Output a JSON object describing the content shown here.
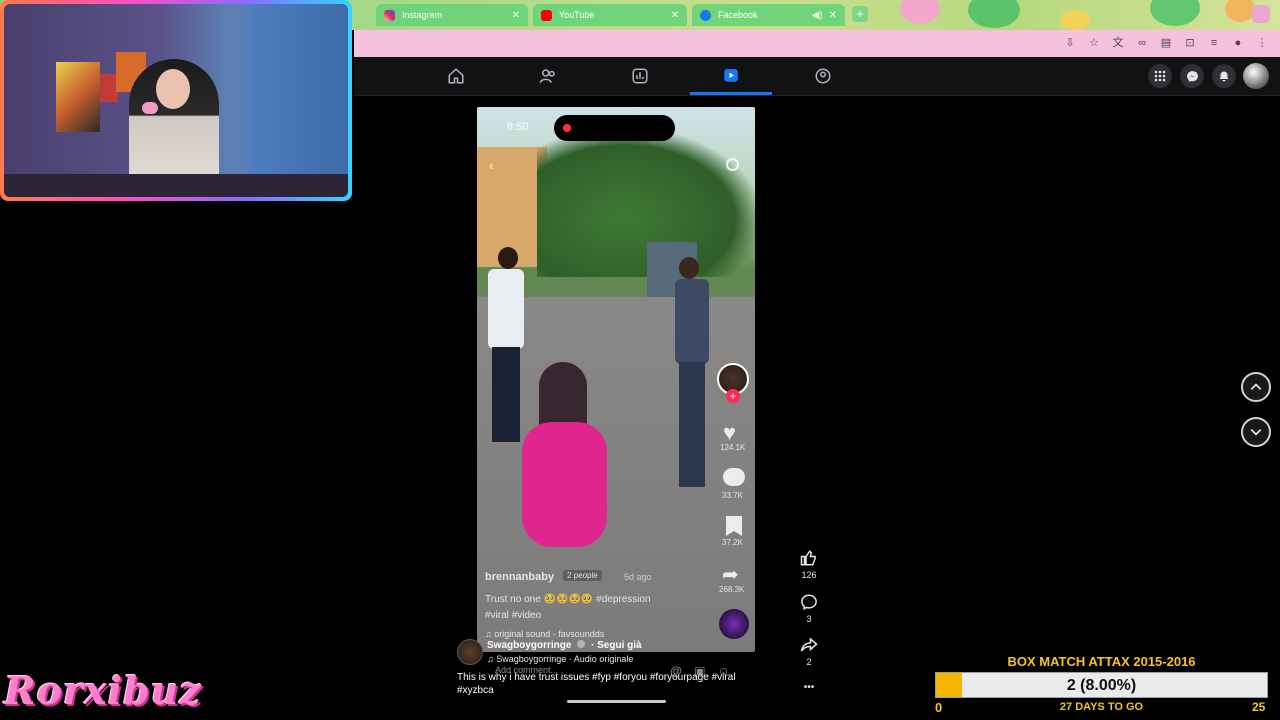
{
  "browser": {
    "tabs": [
      {
        "label": "Instagram",
        "icon": "instagram-icon",
        "color": "#e1306c"
      },
      {
        "label": "YouTube",
        "icon": "youtube-icon",
        "color": "#ff0000"
      },
      {
        "label": "Facebook",
        "icon": "facebook-icon",
        "color": "#1877f2"
      }
    ],
    "new_tab_label": "+"
  },
  "facebook_nav": {
    "items": [
      "home-icon",
      "friends-icon",
      "dashboard-icon",
      "video-icon",
      "groups-icon"
    ],
    "active_index": 3,
    "right_icons": [
      "apps-grid-icon",
      "messenger-icon",
      "notifications-icon",
      "profile-avatar"
    ]
  },
  "video": {
    "time": "8:50",
    "likes": "124.1K",
    "comments": "33.7K",
    "saves": "37.2K",
    "shares": "268.3K",
    "author": "brennanbaby",
    "people_tag": "2 people",
    "age": "5d ago",
    "caption_line1": "Trust no one 🥺🥺🥺🥺 #depression",
    "caption_line2": "#viral #video",
    "sound": "♫ original sound - favsoundds"
  },
  "reel": {
    "like_count": "126",
    "comment_count": "3",
    "share_count": "2",
    "more_label": "•••"
  },
  "post": {
    "author": "Swagboygorringe",
    "follow_label": "Segui già",
    "audio": "♫ Swagboygorringe · Audio originale",
    "add_comment": "Add comment...",
    "caption": "This is why i have trust issues #fyp #foryou #foryourpage #viral #xyzbca"
  },
  "overlay": {
    "brand": "Rorxibuz"
  },
  "box_match": {
    "title": "BOX MATCH ATTAX 2015-2016",
    "value_label": "2 (8.00%)",
    "progress": 0.08,
    "min": "0",
    "max": "25",
    "days_label": "27 DAYS TO GO"
  },
  "colors": {
    "facebook_accent": "#1877f2",
    "progress_fill": "#f4b400",
    "brand_pink": "#ff7fcf",
    "address_bar": "#f5c1dd"
  }
}
